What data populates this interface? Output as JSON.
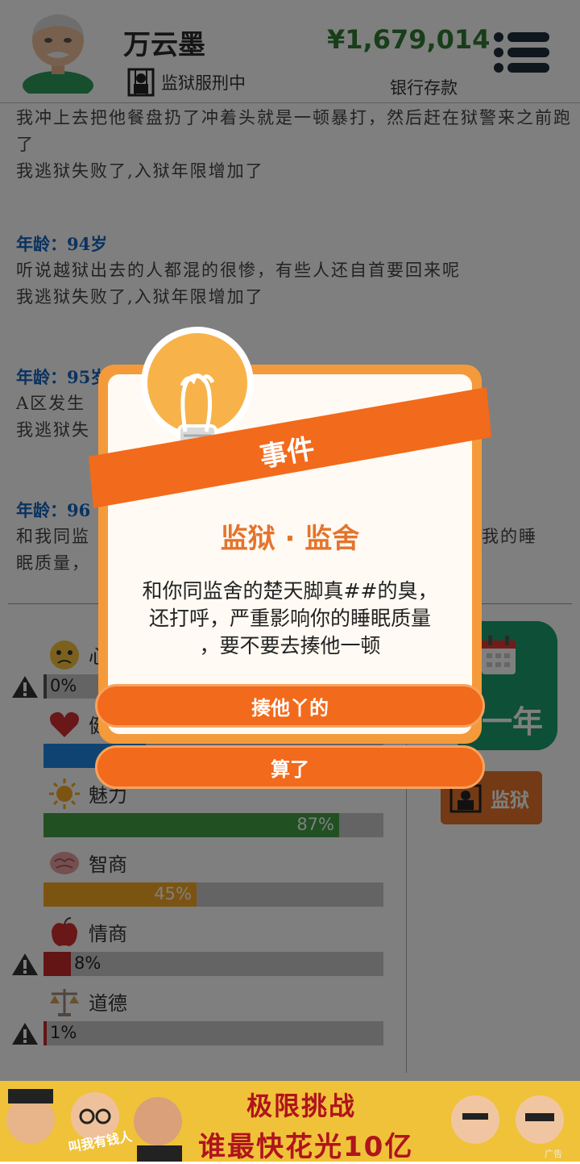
{
  "header": {
    "player_name": "万云墨",
    "status_text": "监狱服刑中",
    "money": "¥1,679,014",
    "money_label": "银行存款",
    "menu_icon": "hamburger-menu-icon"
  },
  "log": [
    {
      "lines": [
        "我冲上去把他餐盘扔了冲着头就是一顿暴打，然后赶在狱警来之前跑了",
        "我逃狱失败了,入狱年限增加了"
      ]
    },
    {
      "age": "年龄：94岁",
      "lines": [
        "听说越狱出去的人都混的很惨，有些人还自首要回来呢",
        "我逃狱失败了,入狱年限增加了"
      ]
    },
    {
      "age": "年龄：95岁",
      "lines": [
        "A区发生",
        "我逃狱失"
      ]
    },
    {
      "age": "年龄：96",
      "lines": [
        "和我同监",
        "眠质量，"
      ],
      "tail": "我的睡"
    }
  ],
  "stats": [
    {
      "key": "mood",
      "label": "心",
      "value_text": "0%",
      "value": 0,
      "color": "#555555",
      "icon": "sad-face-icon",
      "warning": true
    },
    {
      "key": "health",
      "label": "健",
      "value_text": "",
      "value": 30,
      "color": "#1e88e5",
      "icon": "heart-icon",
      "warning": false
    },
    {
      "key": "charm",
      "label": "魅力",
      "value_text": "87%",
      "value": 87,
      "color": "#43a047",
      "icon": "sun-icon",
      "warning": false
    },
    {
      "key": "iq",
      "label": "智商",
      "value_text": "45%",
      "value": 45,
      "color": "#f9a825",
      "icon": "brain-icon",
      "warning": false
    },
    {
      "key": "eq",
      "label": "情商",
      "value_text": "8%",
      "value": 8,
      "color": "#c62828",
      "icon": "apple-icon",
      "warning": true
    },
    {
      "key": "morality",
      "label": "道德",
      "value_text": "1%",
      "value": 1,
      "color": "#c62828",
      "icon": "scales-icon",
      "warning": true
    }
  ],
  "side": {
    "next_year_label": "一年",
    "next_year_icon": "calendar-icon",
    "prison_label": "监狱",
    "prison_icon": "prison-icon"
  },
  "dialog": {
    "banner": "事件",
    "banner_icon": "lightbulb-icon",
    "title": "监狱 · 监舍",
    "body_lines": [
      "和你同监舍的楚天脚真##的臭，",
      "还打呼，严重影响你的睡眠质量",
      "，要不要去揍他一顿"
    ],
    "option1": "揍他丫的",
    "option2": "算了"
  },
  "ad": {
    "line1": "极限挑战",
    "line2": "谁最快花光10亿",
    "small": "叫我有钱人",
    "tag": "广告"
  }
}
